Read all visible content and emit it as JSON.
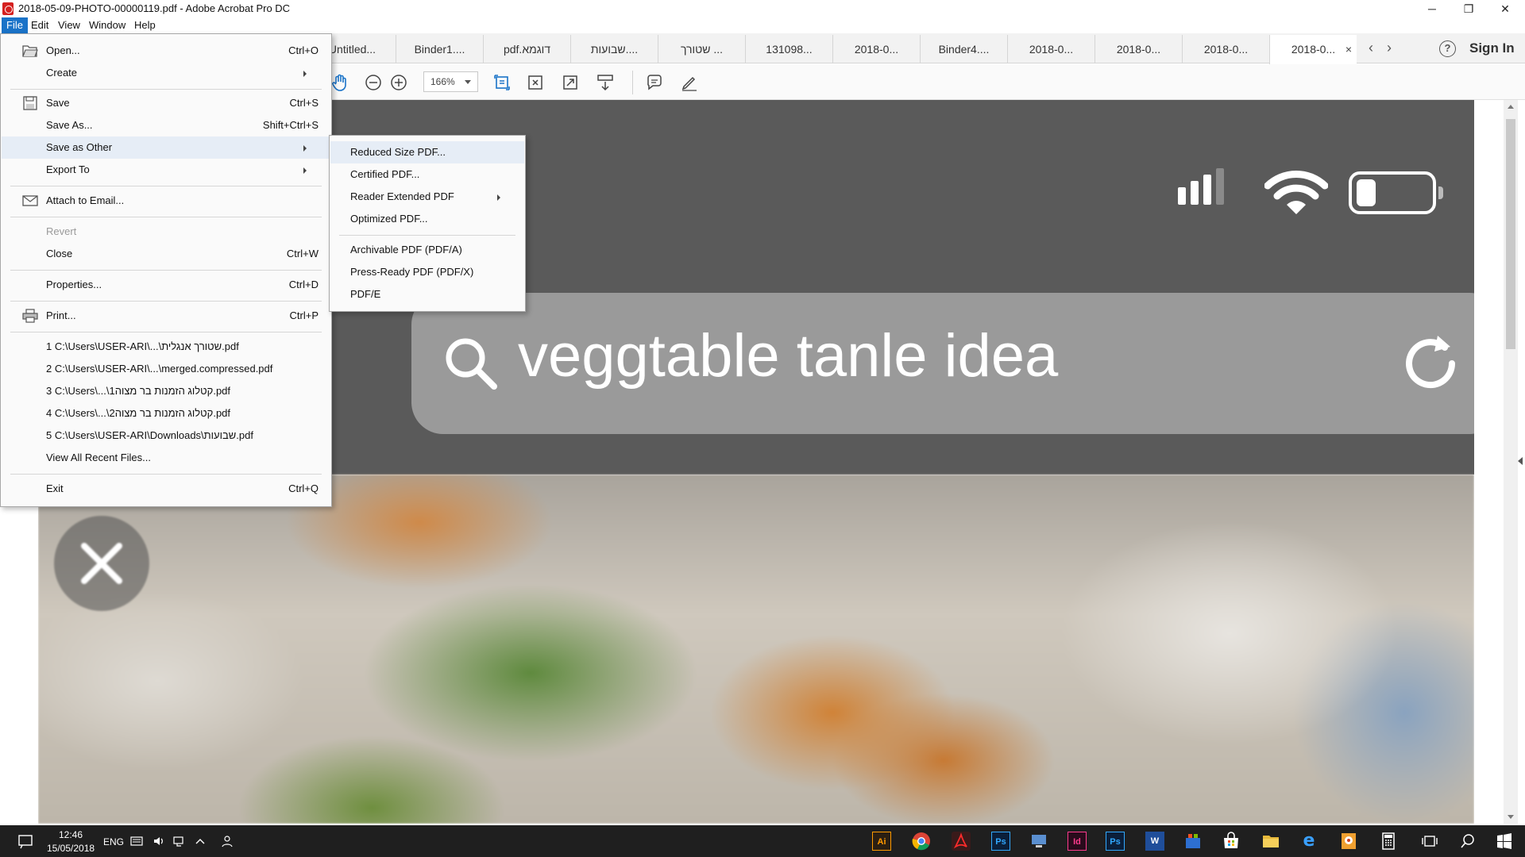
{
  "window": {
    "title": "2018-05-09-PHOTO-00000119.pdf - Adobe Acrobat Pro DC",
    "minimize": "─",
    "restore": "❐",
    "close": "✕"
  },
  "menubar": [
    "File",
    "Edit",
    "View",
    "Window",
    "Help"
  ],
  "tabs": [
    {
      "label": "Untitled..."
    },
    {
      "label": "Binder1...."
    },
    {
      "label": "pdf.דוגמא"
    },
    {
      "label": "שבועות...."
    },
    {
      "label": "שטורך ..."
    },
    {
      "label": "131098..."
    },
    {
      "label": "2018-0..."
    },
    {
      "label": "Binder4...."
    },
    {
      "label": "2018-0..."
    },
    {
      "label": "2018-0..."
    },
    {
      "label": "2018-0..."
    },
    {
      "label": "2018-0...",
      "active": true
    }
  ],
  "tab_close": "×",
  "tab_prev": "‹",
  "tab_next": "›",
  "help": "?",
  "sign_in": "Sign In",
  "toolbar": {
    "zoom": "166%"
  },
  "document": {
    "search_query": "veggtable tanle idea"
  },
  "file_menu": {
    "items": [
      {
        "label": "Open...",
        "shortcut": "Ctrl+O"
      },
      {
        "label": "Create",
        "shortcut": ""
      },
      {
        "label": "Save",
        "shortcut": "Ctrl+S"
      },
      {
        "label": "Save As...",
        "shortcut": "Shift+Ctrl+S"
      },
      {
        "label": "Save as Other",
        "shortcut": ""
      },
      {
        "label": "Export To",
        "shortcut": ""
      },
      {
        "label": "Attach to Email...",
        "shortcut": ""
      },
      {
        "label": "Revert",
        "shortcut": ""
      },
      {
        "label": "Close",
        "shortcut": "Ctrl+W"
      },
      {
        "label": "Properties...",
        "shortcut": "Ctrl+D"
      },
      {
        "label": "Print...",
        "shortcut": "Ctrl+P"
      },
      {
        "label": "1 C:\\Users\\USER-ARI\\...\\שטורך אנגלית.pdf",
        "shortcut": ""
      },
      {
        "label": "2 C:\\Users\\USER-ARI\\...\\merged.compressed.pdf",
        "shortcut": ""
      },
      {
        "label": "3 C:\\Users\\...\\קטלוג הזמנות בר מצוה1.pdf",
        "shortcut": ""
      },
      {
        "label": "4 C:\\Users\\...\\קטלוג הזמנות בר מצוה2.pdf",
        "shortcut": ""
      },
      {
        "label": "5 C:\\Users\\USER-ARI\\Downloads\\שבועות.pdf",
        "shortcut": ""
      },
      {
        "label": "View All Recent Files...",
        "shortcut": ""
      },
      {
        "label": "Exit",
        "shortcut": "Ctrl+Q"
      }
    ]
  },
  "save_as_other_menu": {
    "items": [
      {
        "label": "Reduced Size PDF..."
      },
      {
        "label": "Certified PDF..."
      },
      {
        "label": "Reader Extended PDF"
      },
      {
        "label": "Optimized PDF..."
      },
      {
        "label": "Archivable PDF (PDF/A)"
      },
      {
        "label": "Press-Ready PDF (PDF/X)"
      },
      {
        "label": "PDF/E"
      }
    ]
  },
  "taskbar": {
    "time": "12:46",
    "date": "15/05/2018",
    "language": "ENG",
    "apps": [
      {
        "name": "illustrator-icon",
        "text": "Ai",
        "bg": "#2b1f12",
        "fg": "#ff9a00"
      },
      {
        "name": "chrome-icon",
        "text": "",
        "bg": "#1f1f1f",
        "fg": "#ffffff"
      },
      {
        "name": "acrobat-icon",
        "text": "",
        "bg": "#3a1a1a",
        "fg": "#ff2b2b"
      },
      {
        "name": "photoshop-icon",
        "text": "Ps",
        "bg": "#0b1f3a",
        "fg": "#31a8ff"
      },
      {
        "name": "network-app-icon",
        "text": "",
        "bg": "#1f1f1f",
        "fg": "#ffffff"
      },
      {
        "name": "indesign-icon",
        "text": "Id",
        "bg": "#2a0b1c",
        "fg": "#ff3b8d"
      },
      {
        "name": "photoshop2-icon",
        "text": "Ps",
        "bg": "#0b1f3a",
        "fg": "#31a8ff"
      },
      {
        "name": "word-icon",
        "text": "W",
        "bg": "#1f4e9a",
        "fg": "#ffffff"
      },
      {
        "name": "store-people-icon",
        "text": "",
        "bg": "#1f1f1f",
        "fg": "#ffffff"
      },
      {
        "name": "store-icon",
        "text": "",
        "bg": "#1f1f1f",
        "fg": "#ffffff"
      },
      {
        "name": "folder-icon",
        "text": "",
        "bg": "#e8b93a",
        "fg": "#ffffff"
      },
      {
        "name": "edge-icon",
        "text": "e",
        "bg": "#1f1f1f",
        "fg": "#3aa0ff"
      },
      {
        "name": "paint-icon",
        "text": "",
        "bg": "#f0a030",
        "fg": "#ffffff"
      },
      {
        "name": "calculator-icon",
        "text": "",
        "bg": "#1f1f1f",
        "fg": "#ffffff"
      }
    ]
  },
  "colors": {
    "menu_highlight": "#e6edf6",
    "menubar_active": "#1a73c8",
    "taskbar": "#1f1f1f",
    "phone_bg": "#5a5a5a",
    "search_bar": "#9a9a9a"
  }
}
